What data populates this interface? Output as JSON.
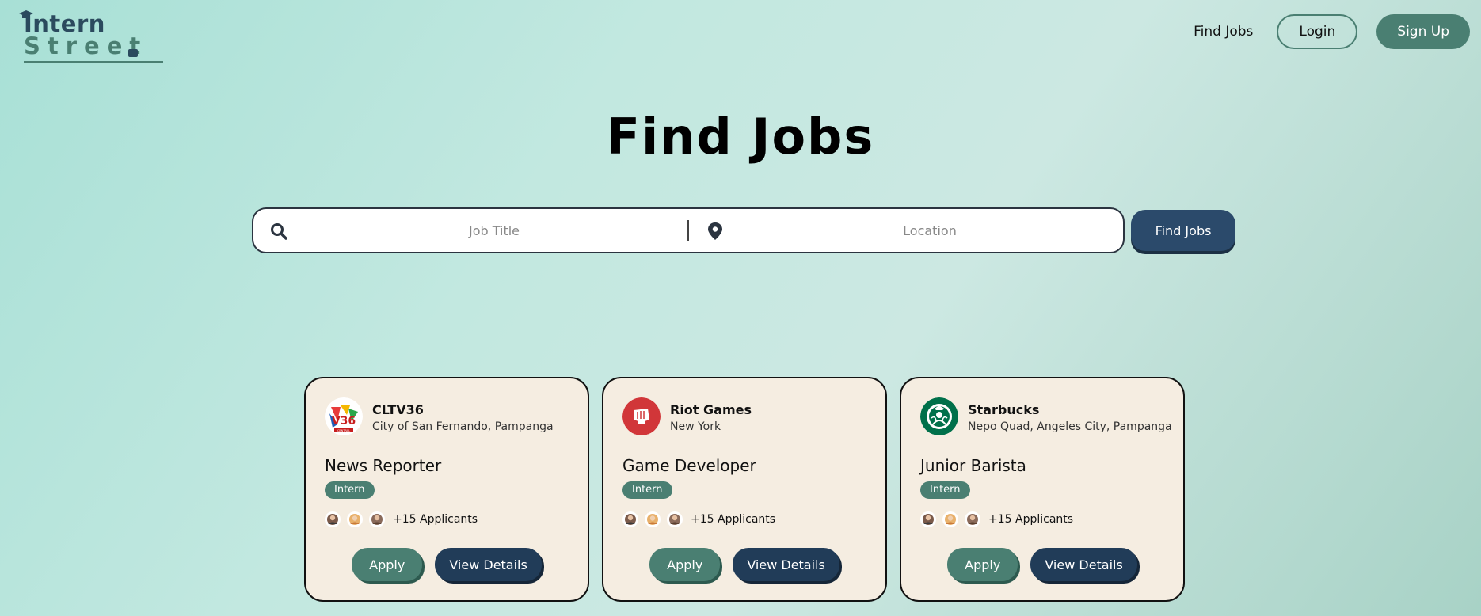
{
  "header": {
    "logo": {
      "line1": "Intern",
      "line2": "Street"
    },
    "nav": {
      "find_jobs": "Find Jobs",
      "login": "Login",
      "signup": "Sign Up"
    }
  },
  "main": {
    "title": "Find Jobs",
    "search": {
      "job_title_placeholder": "Job Title",
      "job_title_value": "",
      "location_placeholder": "Location",
      "location_value": "",
      "button": "Find Jobs"
    },
    "jobs": [
      {
        "company": "CLTV36",
        "location": "City of San Fernando, Pampanga",
        "title": "News Reporter",
        "tag": "Intern",
        "applicants": "+15 Applicants",
        "apply": "Apply",
        "details": "View Details",
        "logo_text": "CENTRAL"
      },
      {
        "company": "Riot Games",
        "location": "New York",
        "title": "Game Developer",
        "tag": "Intern",
        "applicants": "+15 Applicants",
        "apply": "Apply",
        "details": "View Details"
      },
      {
        "company": "Starbucks",
        "location": "Nepo Quad, Angeles City, Pampanga",
        "title": "Junior Barista",
        "tag": "Intern",
        "applicants": "+15 Applicants",
        "apply": "Apply",
        "details": "View Details"
      }
    ]
  },
  "colors": {
    "primary_green": "#4a7f72",
    "navy": "#2b4a6b",
    "card_bg": "#f5ede1",
    "riot_red": "#d13639",
    "starbucks_green": "#00704a"
  },
  "icons": {
    "search": "search-icon",
    "location": "map-pin-icon",
    "logo_cap": "graduation-cap-icon",
    "logo_bag": "briefcase-icon"
  }
}
